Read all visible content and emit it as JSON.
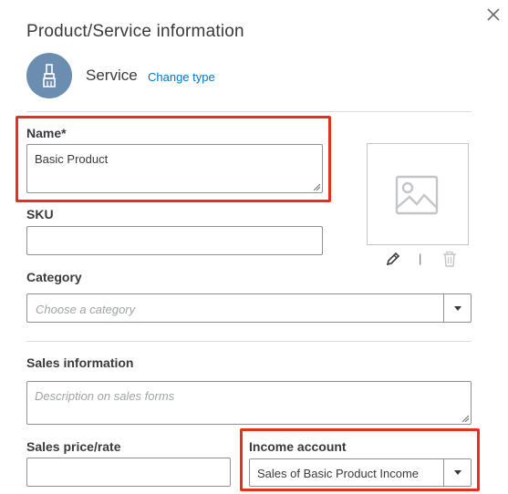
{
  "dialog": {
    "title": "Product/Service information",
    "type_label": "Service",
    "change_type_link": "Change type"
  },
  "fields": {
    "name": {
      "label": "Name*",
      "value": "Basic Product"
    },
    "sku": {
      "label": "SKU",
      "value": ""
    },
    "category": {
      "label": "Category",
      "placeholder": "Choose a category"
    },
    "sales_information": {
      "label": "Sales information",
      "placeholder": "Description on sales forms"
    },
    "sales_price": {
      "label": "Sales price/rate",
      "value": ""
    },
    "income_account": {
      "label": "Income account",
      "value": "Sales of Basic Product Income"
    }
  },
  "image": {
    "separator": "|"
  },
  "colors": {
    "highlight": "#e5301b",
    "link": "#0077c5",
    "avatar_bg": "#6b8eb0"
  }
}
